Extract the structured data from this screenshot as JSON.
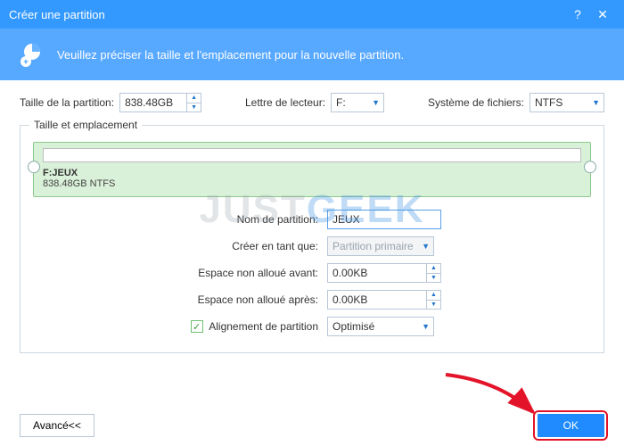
{
  "titlebar": {
    "title": "Créer une partition"
  },
  "banner": {
    "text": "Veuillez préciser la taille et l'emplacement pour la nouvelle partition."
  },
  "row1": {
    "size_label": "Taille de la partition:",
    "size_value": "838.48GB",
    "drive_label": "Lettre de lecteur:",
    "drive_value": "F:",
    "fs_label": "Système de fichiers:",
    "fs_value": "NTFS"
  },
  "fieldset": {
    "legend": "Taille et emplacement",
    "vis_name": "F:JEUX",
    "vis_detail": "838.48GB NTFS"
  },
  "form": {
    "name_label": "Nom de partition:",
    "name_value": "JEUX",
    "create_as_label": "Créer en tant que:",
    "create_as_value": "Partition primaire",
    "before_label": "Espace non alloué avant:",
    "before_value": "0.00KB",
    "after_label": "Espace non alloué après:",
    "after_value": "0.00KB",
    "align_label": "Alignement de partition",
    "align_value": "Optimisé"
  },
  "footer": {
    "advanced": "Avancé<<",
    "ok": "OK"
  },
  "watermark": {
    "a": "JUST",
    "b": "GEEK"
  }
}
